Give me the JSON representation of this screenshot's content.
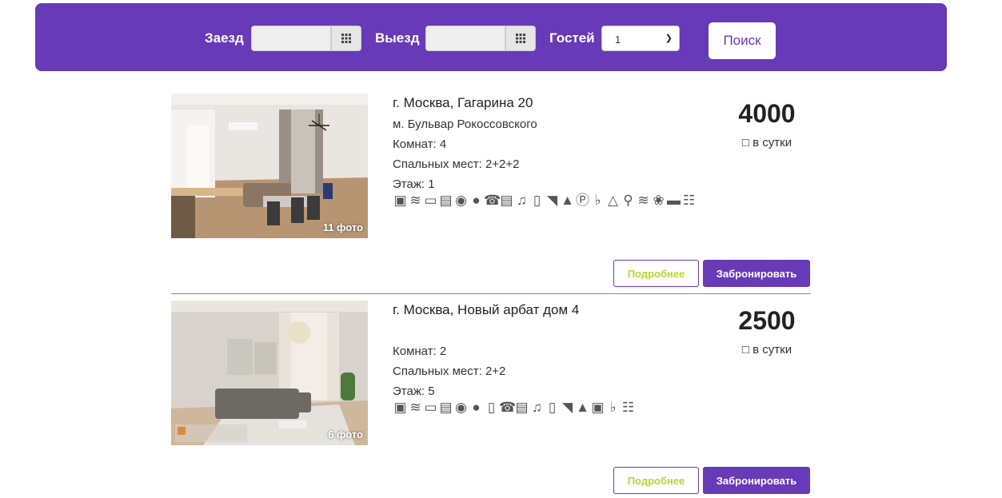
{
  "search": {
    "checkin_label": "Заезд",
    "checkin_value": "",
    "checkout_label": "Выезд",
    "checkout_value": "",
    "guests_label": "Гостей",
    "guests_value": "1",
    "search_button": "Поиск"
  },
  "listings": [
    {
      "photo_count": "11 фото",
      "address": "г. Москва, Гагарина 20",
      "metro": "м. Бульвар Рокоссовского",
      "rooms": "Комнат: 4",
      "beds": "Спальных мест: 2+2+2",
      "floor": "Этаж: 1",
      "price": "4000",
      "per_day": "в сутки",
      "amenities": [
        "washing-machine",
        "wifi",
        "tv",
        "air-conditioner",
        "baby-stroller",
        "people",
        "phone",
        "microwave",
        "music",
        "fridge",
        "iron",
        "pets",
        "parking",
        "hair-dryer",
        "hanger",
        "shower",
        "hot-tub",
        "flowers",
        "kitchen",
        "crib"
      ],
      "more_button": "Подробнее",
      "book_button": "Забронировать"
    },
    {
      "photo_count": "6 фото",
      "address": "г. Москва, Новый арбат дом 4",
      "metro": "",
      "rooms": "Комнат: 2",
      "beds": "Спальных мест: 2+2",
      "floor": "Этаж: 5",
      "price": "2500",
      "per_day": "в сутки",
      "amenities": [
        "washing-machine",
        "wifi",
        "tv",
        "air-conditioner",
        "baby-stroller",
        "people",
        "wardrobe",
        "phone",
        "microwave",
        "music",
        "fridge",
        "iron",
        "pets",
        "lock",
        "hair-dryer",
        "crib"
      ],
      "more_button": "Подробнее",
      "book_button": "Забронировать"
    }
  ],
  "colors": {
    "accent": "#673ab7",
    "more_text": "#b5d730"
  }
}
